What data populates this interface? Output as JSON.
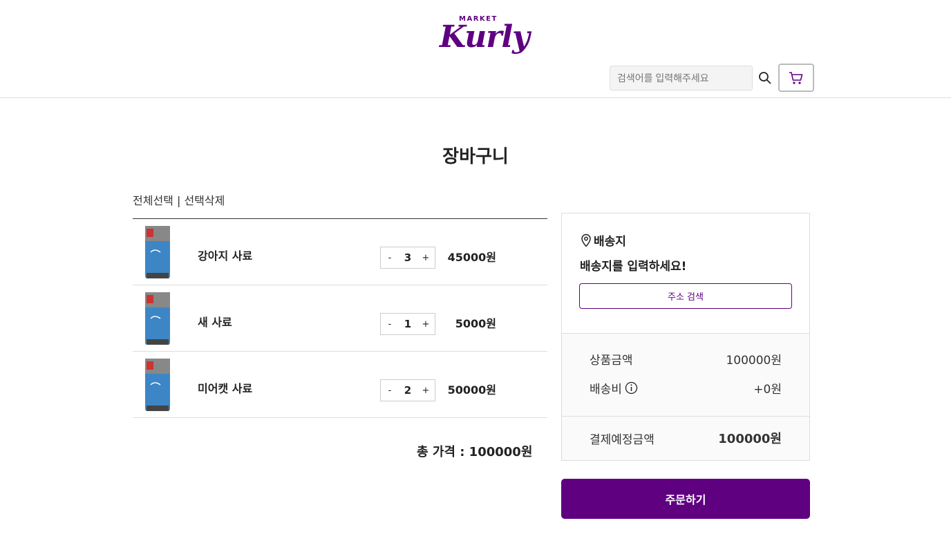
{
  "header": {
    "logo_top": "MARKET",
    "logo_main": "Kurly",
    "search_placeholder": "검색어를 입력해주세요"
  },
  "page_title": "장바구니",
  "selection": {
    "select_all": "전체선택",
    "separator": " | ",
    "delete_selected": "선택삭제"
  },
  "items": [
    {
      "name": "강아지 사료",
      "qty": "3",
      "price": "45000원"
    },
    {
      "name": "새 사료",
      "qty": "1",
      "price": "5000원"
    },
    {
      "name": "미어캣 사료",
      "qty": "2",
      "price": "50000원"
    }
  ],
  "qty_minus": "-",
  "qty_plus": "+",
  "total_label": "총 가격 : 100000원",
  "delivery": {
    "title": "배송지",
    "message": "배송지를 입력하세요!",
    "search_button": "주소 검색"
  },
  "summary": {
    "product_label": "상품금액",
    "product_value": "100000원",
    "shipping_label": "배송비",
    "shipping_value": "+0원",
    "payment_label": "결제예정금액",
    "payment_value": "100000원"
  },
  "order_button": "주문하기",
  "colors": {
    "accent": "#5f0080",
    "product_blue": "#3d86c6"
  },
  "icons": [
    "search-icon",
    "cart-icon",
    "location-pin-icon",
    "info-icon"
  ]
}
